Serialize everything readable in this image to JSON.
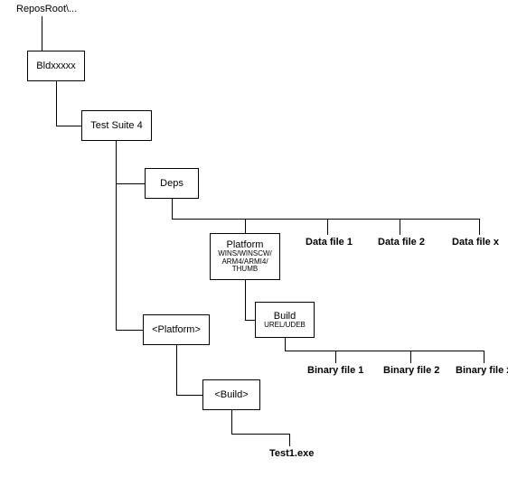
{
  "root_label": "ReposRoot\\...",
  "nodes": {
    "bld": "Bldxxxxx",
    "testsuite": "Test Suite 4",
    "deps": "Deps",
    "platform_title": "Platform",
    "platform_sub": "WINS/WINSCW/ ARM4/ARMI4/ THUMB",
    "build_title": "Build",
    "build_sub": "UREL/UDEB",
    "platform2": "<Platform>",
    "build2": "<Build>"
  },
  "data_files": [
    "Data file  1",
    "Data file  2",
    "Data file  x"
  ],
  "binary_files": [
    "Binary file 1",
    "Binary file 2",
    "Binary file x"
  ],
  "test_exe": "Test1.exe"
}
